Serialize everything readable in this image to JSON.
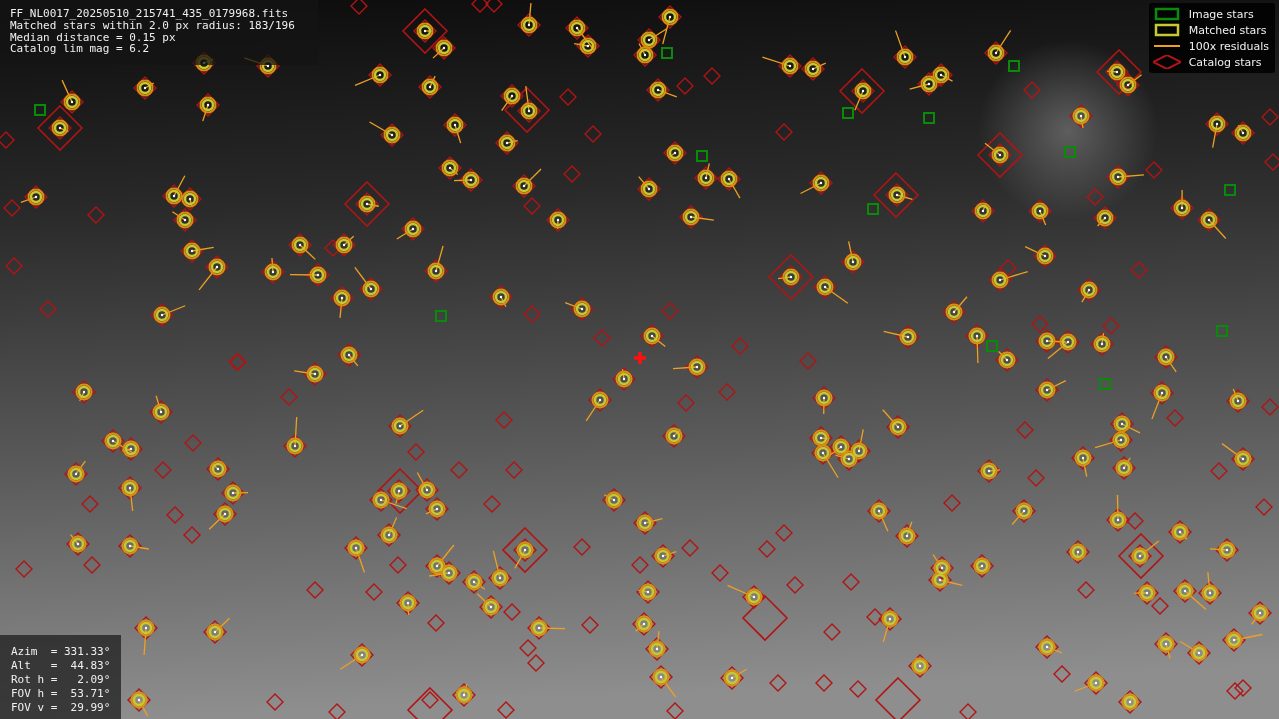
{
  "file_info": {
    "lines": [
      "FF_NL0017_20250510_215741_435_0179968.fits",
      "Matched stars within 2.0 px radius: 183/196",
      "Median distance = 0.15 px",
      "Catalog lim mag = 6.2"
    ]
  },
  "legend": [
    {
      "label": "Image stars",
      "kind": "box",
      "color": "#0a8a0a"
    },
    {
      "label": "Matched stars",
      "kind": "box",
      "color": "#c8c832"
    },
    {
      "label": "100x residuals",
      "kind": "line",
      "color": "#f0a020"
    },
    {
      "label": "Catalog stars",
      "kind": "diamond",
      "color": "#b01414"
    }
  ],
  "pointing": {
    "lines": [
      "Azim  = 331.33°",
      "Alt   =  44.83°",
      "Rot h =   2.09°",
      "FOV h =  53.71°",
      "FOV v =  29.99°"
    ]
  }
}
